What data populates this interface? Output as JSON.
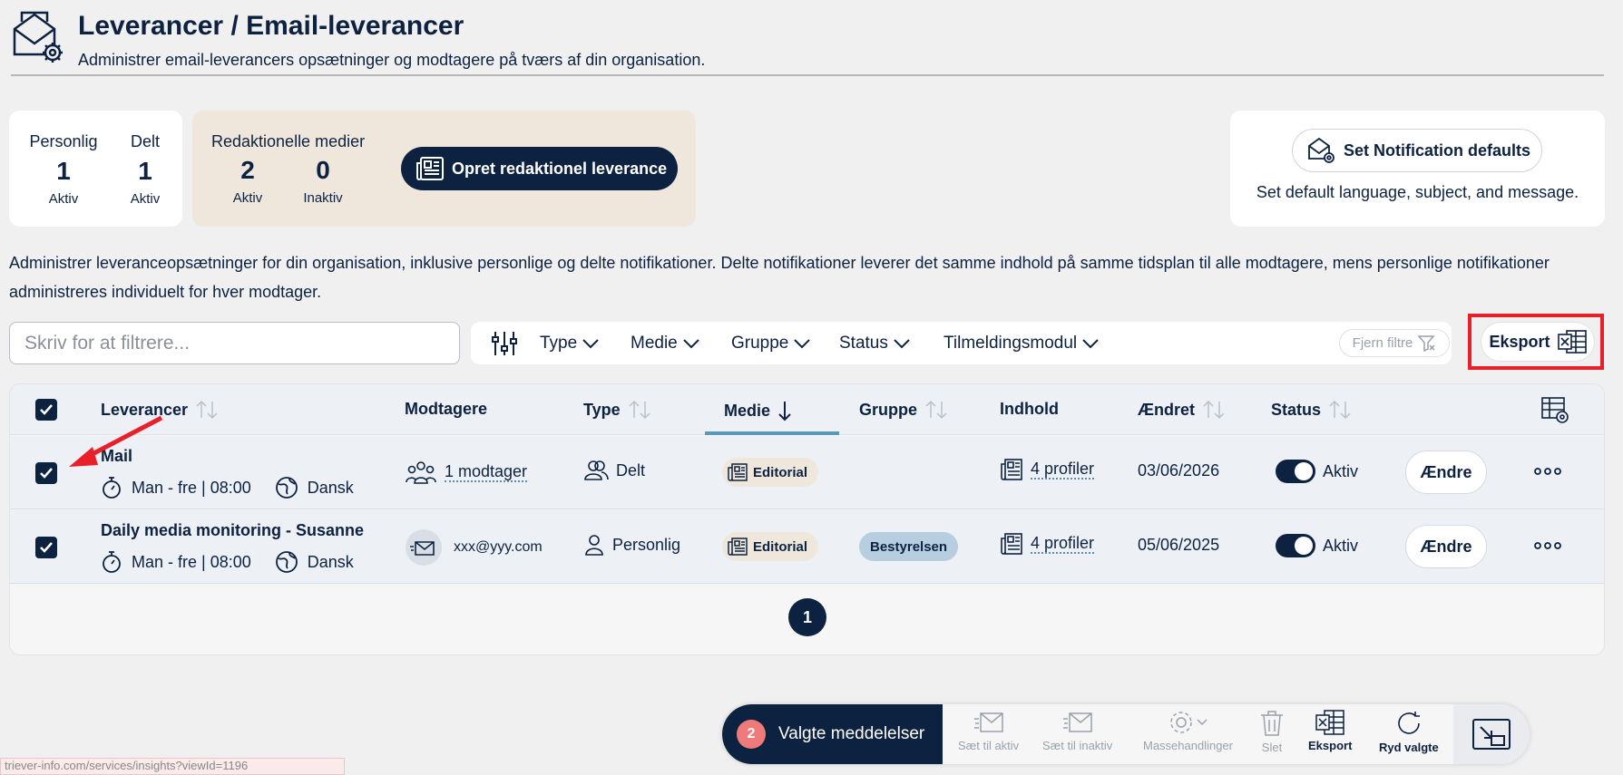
{
  "header": {
    "title": "Leverancer / Email-leverancer",
    "subtitle": "Administrer email-leverancers opsætninger og modtagere på tværs af din organisation."
  },
  "stats": {
    "personal": {
      "label": "Personlig",
      "value": "1",
      "sub": "Aktiv"
    },
    "shared": {
      "label": "Delt",
      "value": "1",
      "sub": "Aktiv"
    },
    "editorial": {
      "title": "Redaktionelle medier",
      "active": {
        "value": "2",
        "sub": "Aktiv"
      },
      "inactive": {
        "value": "0",
        "sub": "Inaktiv"
      },
      "button_label": "Opret redaktionel leverance"
    },
    "notifications": {
      "button_label": "Set Notification defaults",
      "description": "Set default language, subject, and message."
    }
  },
  "info_text": "Administrer leveranceopsætninger for din organisation, inklusive personlige og delte notifikationer. Delte notifikationer leverer det samme indhold på samme tidsplan til alle modtagere, mens personlige notifikationer administreres individuelt for hver modtager.",
  "filters": {
    "search_placeholder": "Skriv for at filtrere...",
    "items": [
      "Type",
      "Medie",
      "Gruppe",
      "Status",
      "Tilmeldingsmodul"
    ],
    "clear_label": "Fjern filtre",
    "export_label": "Eksport"
  },
  "table": {
    "columns": [
      "Leverancer",
      "Modtagere",
      "Type",
      "Medie",
      "Gruppe",
      "Indhold",
      "Ændret",
      "Status"
    ],
    "rows": [
      {
        "name": "Mail",
        "schedule": "Man - fre | 08:00",
        "language": "Dansk",
        "recipients": "1 modtager",
        "type": "Delt",
        "medie": "Editorial",
        "group": "",
        "content": "4 profiler",
        "changed": "03/06/2026",
        "status": "Aktiv",
        "edit_label": "Ændre"
      },
      {
        "name": "Daily media monitoring - Susanne",
        "schedule": "Man - fre | 08:00",
        "language": "Dansk",
        "recipients": "xxx@yyy.com",
        "type": "Personlig",
        "medie": "Editorial",
        "group": "Bestyrelsen",
        "content": "4 profiler",
        "changed": "05/06/2025",
        "status": "Aktiv",
        "edit_label": "Ændre"
      }
    ],
    "page": "1"
  },
  "action_bar": {
    "count": "2",
    "label": "Valgte meddelelser",
    "actions": [
      "Sæt til aktiv",
      "Sæt til inaktiv",
      "Massehandlinger",
      "Slet",
      "Eksport",
      "Ryd valgte"
    ]
  },
  "status_url": "triever-info.com/services/insights?viewId=1196",
  "colors": {
    "navy": "#0d2240",
    "highlight_red": "#e8202a",
    "editorial_bg": "#efe6dc",
    "group_badge": "#b7cde0"
  }
}
